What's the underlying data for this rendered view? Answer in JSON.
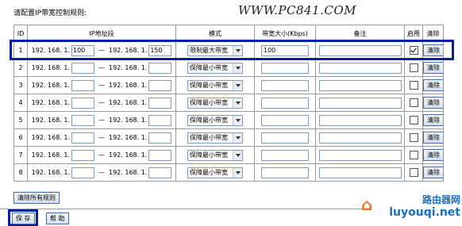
{
  "header": {
    "title": "请配置IP带宽控制规则:",
    "watermark": "WWW.PC841.COM"
  },
  "table": {
    "columns": [
      "ID",
      "IP地址段",
      "模式",
      "带宽大小(Kbps)",
      "备注",
      "启用",
      "清除"
    ],
    "ip_prefix": "192. 168. 1.",
    "ip_separator": "—",
    "rows": [
      {
        "id": "1",
        "ip_start": "100",
        "ip_end": "150",
        "mode": "限制最大带宽",
        "bandwidth": "100",
        "note": "",
        "enabled": true
      },
      {
        "id": "2",
        "ip_start": "",
        "ip_end": "",
        "mode": "保障最小带宽",
        "bandwidth": "",
        "note": "",
        "enabled": false
      },
      {
        "id": "3",
        "ip_start": "",
        "ip_end": "",
        "mode": "保障最小带宽",
        "bandwidth": "",
        "note": "",
        "enabled": false
      },
      {
        "id": "4",
        "ip_start": "",
        "ip_end": "",
        "mode": "保障最小带宽",
        "bandwidth": "",
        "note": "",
        "enabled": false
      },
      {
        "id": "5",
        "ip_start": "",
        "ip_end": "",
        "mode": "保障最小带宽",
        "bandwidth": "",
        "note": "",
        "enabled": false
      },
      {
        "id": "6",
        "ip_start": "",
        "ip_end": "",
        "mode": "保障最小带宽",
        "bandwidth": "",
        "note": "",
        "enabled": false
      },
      {
        "id": "7",
        "ip_start": "",
        "ip_end": "",
        "mode": "保障最小带宽",
        "bandwidth": "",
        "note": "",
        "enabled": false
      },
      {
        "id": "8",
        "ip_start": "",
        "ip_end": "",
        "mode": "保障最小带宽",
        "bandwidth": "",
        "note": "",
        "enabled": false
      }
    ],
    "clear_label": "清除"
  },
  "buttons": {
    "clear_all": "清除所有规则",
    "save": "保 存",
    "help": "帮 助"
  },
  "logo": {
    "cn": "路由器网",
    "en": "luyouqi.net"
  },
  "colors": {
    "highlight": "#0a1fa0",
    "logo": "#1a6fc2"
  }
}
